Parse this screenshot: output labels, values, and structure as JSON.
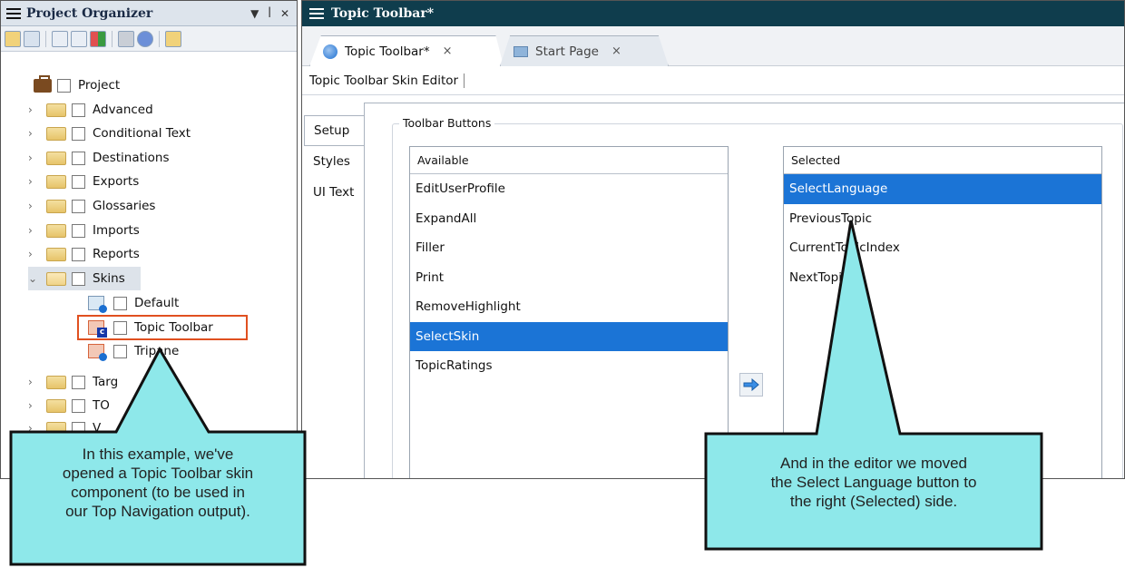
{
  "left_pane": {
    "title": "Project Organizer",
    "pin_glyph": "▾ ⊥ ×"
  },
  "tree": {
    "root": "Project",
    "folders": [
      "Advanced",
      "Conditional Text",
      "Destinations",
      "Exports",
      "Glossaries",
      "Imports",
      "Reports",
      "Skins"
    ],
    "skins": [
      "Default",
      "Topic Toolbar",
      "Tripane"
    ],
    "after": [
      "Targ",
      "TO",
      "V"
    ]
  },
  "right_pane": {
    "window_title": "Topic Toolbar*",
    "tabs": [
      {
        "label": "Topic Toolbar*",
        "close": "×"
      },
      {
        "label": "Start Page",
        "close": "×"
      }
    ],
    "editor_title": "Topic Toolbar Skin Editor",
    "side_tabs": [
      "Setup",
      "Styles",
      "UI Text"
    ],
    "group_label": "Toolbar Buttons",
    "available": {
      "header": "Available",
      "items": [
        "EditUserProfile",
        "ExpandAll",
        "Filler",
        "Print",
        "RemoveHighlight",
        "SelectSkin",
        "TopicRatings"
      ],
      "selected_item": "SelectSkin"
    },
    "selected": {
      "header": "Selected",
      "items": [
        "SelectLanguage",
        "PreviousTopic",
        "CurrentTopicIndex",
        "NextTopic"
      ],
      "selected_item": "SelectLanguage"
    }
  },
  "callouts": {
    "left": "In this example, we've opened a Topic Toolbar skin component (to be used in our Top Navigation output).",
    "left_lines": [
      "In this example, we've",
      "opened a Topic Toolbar skin",
      "component (to be used in",
      "our Top Navigation output)."
    ],
    "right_lines": [
      "And in the editor we moved",
      "the Select Language button to",
      "the right (Selected) side."
    ]
  },
  "colors": {
    "title_bar_dark": "#0f3d4d",
    "selection_blue": "#1b74d6",
    "callout_fill": "#8ee8ea",
    "highlight_orange": "#e05020"
  }
}
